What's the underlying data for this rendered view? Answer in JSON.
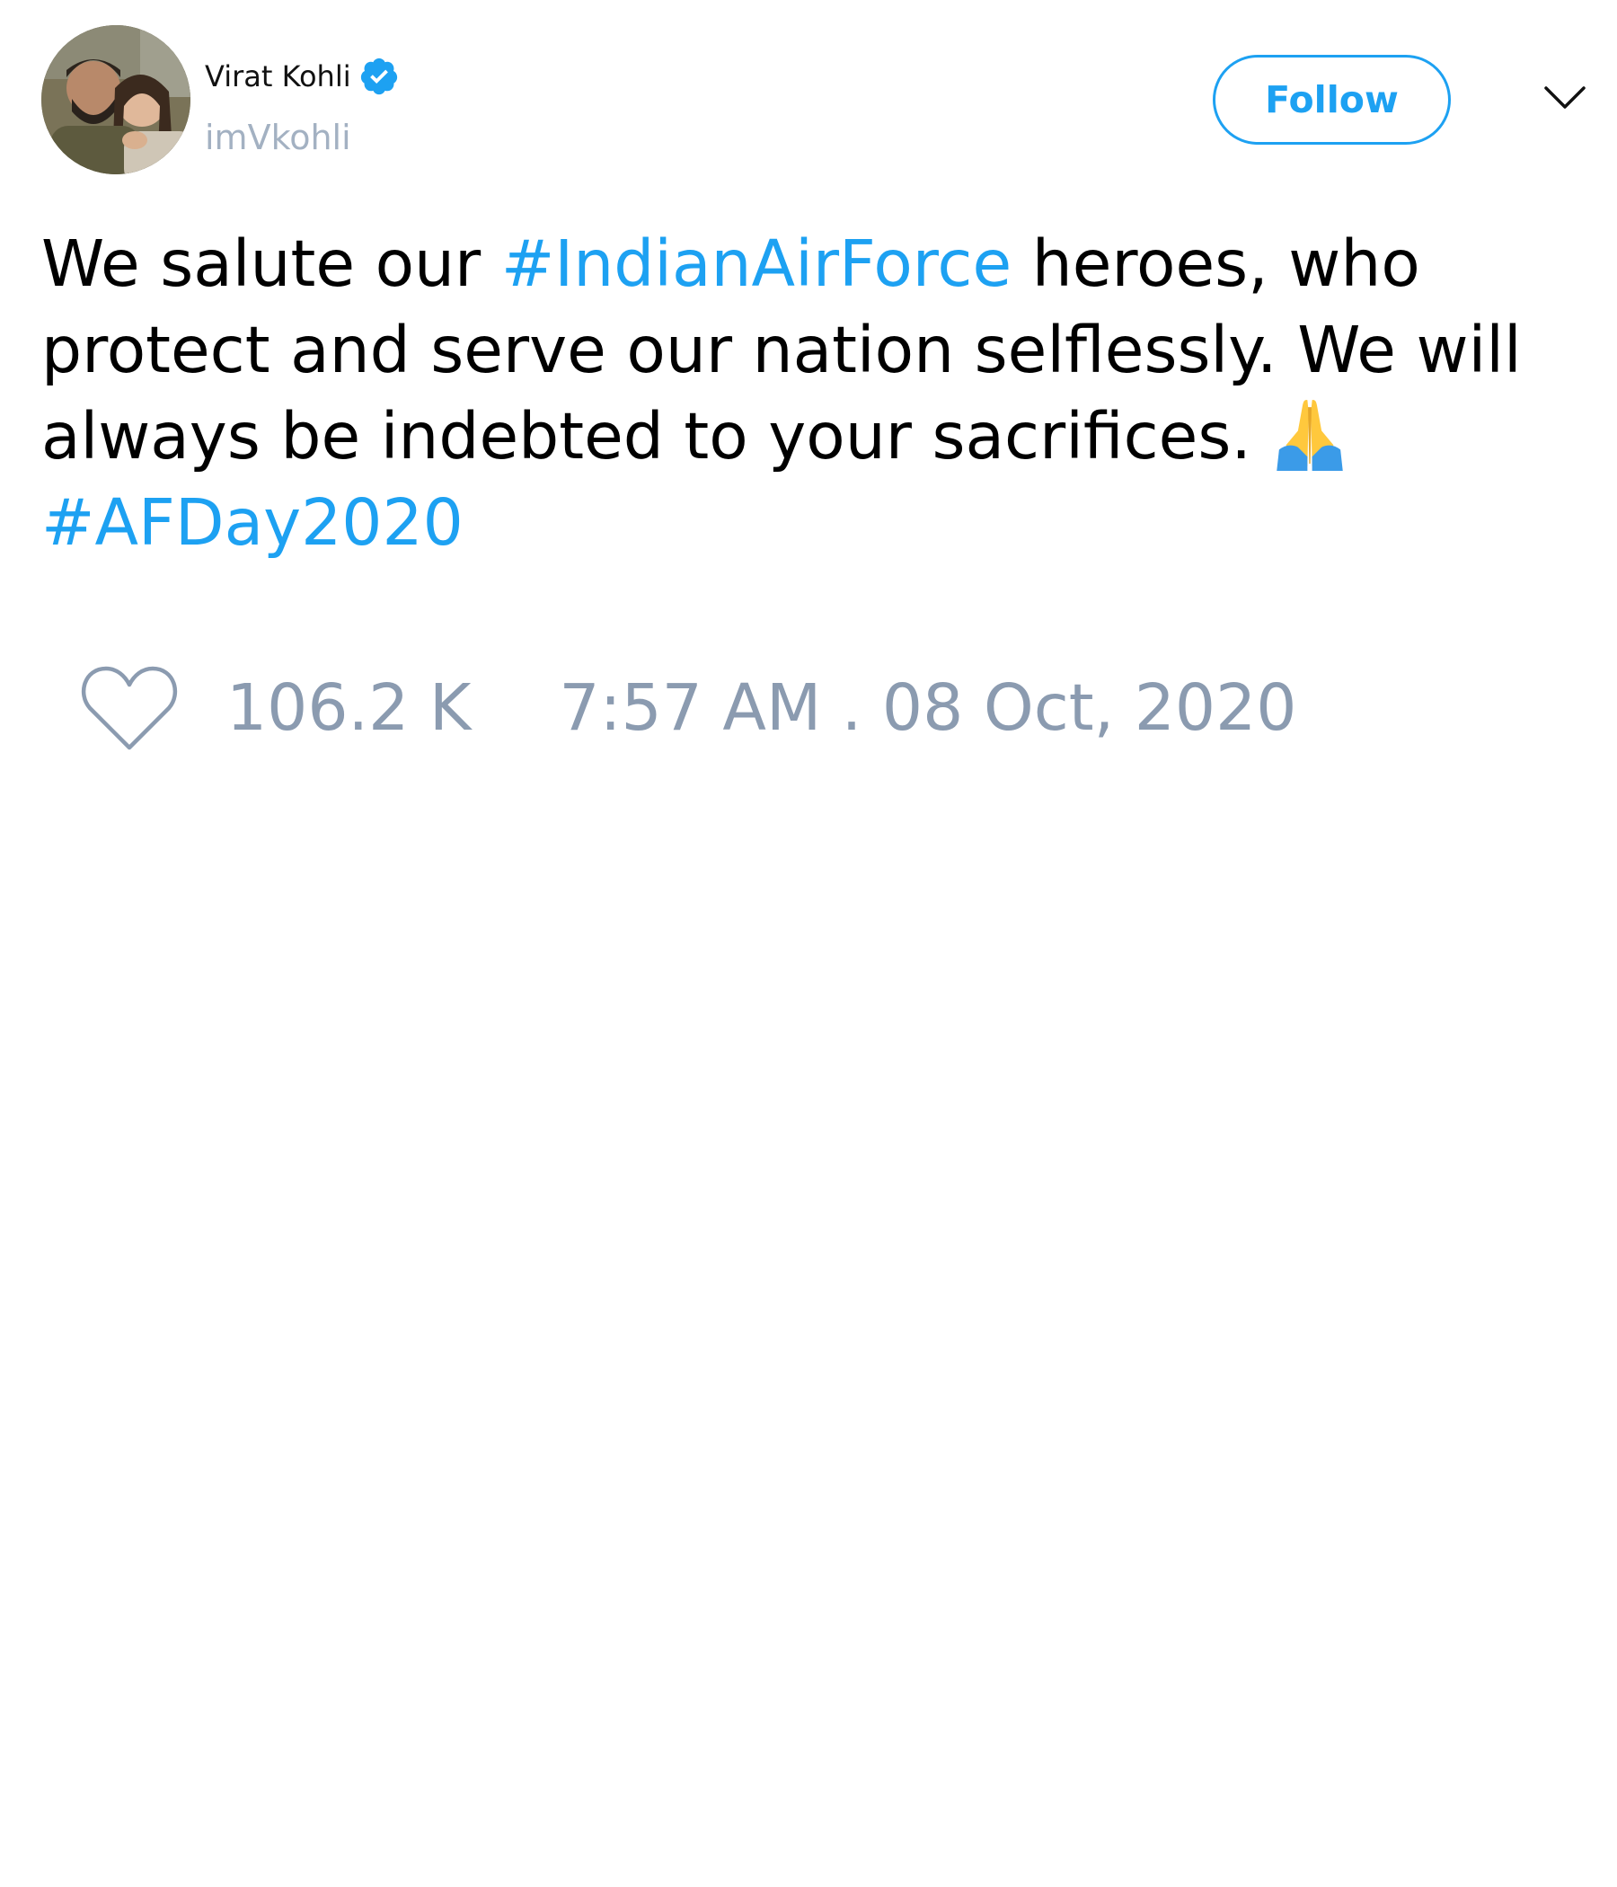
{
  "author": {
    "display_name": "Virat Kohli",
    "handle": "imVkohli",
    "verified": true,
    "avatar": "avatar-photo"
  },
  "follow_button": {
    "label": "Follow"
  },
  "menu": {
    "icon": "chevron-down-icon"
  },
  "tweet": {
    "text_part1": "We salute our ",
    "hashtag1": "#IndianAirForce",
    "text_part2": " heroes, who protect and serve our nation selflessly. We will always be indebted to your sacrifices. ",
    "emoji": "folded-hands-emoji",
    "hashtag2": "#AFDay2020"
  },
  "stats": {
    "like_icon": "heart-icon",
    "likes": "106.2 K",
    "timestamp": "7:57 AM . 08 Oct, 2020"
  },
  "colors": {
    "accent": "#1da1f2",
    "muted": "#8b9bb0",
    "handle": "#a3b1c2",
    "text": "#000000",
    "background": "#ffffff"
  }
}
